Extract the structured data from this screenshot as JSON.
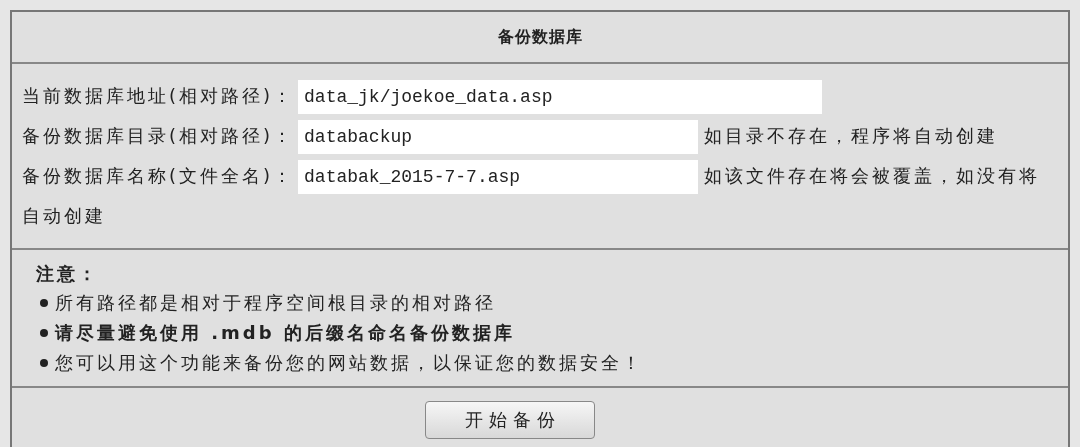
{
  "panel": {
    "title": "备份数据库"
  },
  "fields": [
    {
      "label": "当前数据库地址(相对路径)：",
      "value": "data_jk/joekoe_data.asp",
      "wide": true
    },
    {
      "label": "备份数据库目录(相对路径)：",
      "value": "databackup",
      "wide": false,
      "hint": "如目录不存在，程序将自动创建"
    },
    {
      "label": "备份数据库名称(文件全名)：",
      "value": "databak_2015-7-7.asp",
      "wide": false,
      "hint": "如该文件存在将会被覆盖，如没有将",
      "hint_continued": "自动创建"
    }
  ],
  "notes": {
    "heading": "注意：",
    "items": [
      {
        "text": "所有路径都是相对于程序空间根目录的相对路径",
        "bold": false
      },
      {
        "text": "请尽量避免使用 .mdb 的后缀名命名备份数据库",
        "bold": true
      },
      {
        "text": "您可以用这个功能来备份您的网站数据，以保证您的数据安全！",
        "bold": false
      }
    ]
  },
  "button": {
    "label": "开 始 备 份"
  }
}
